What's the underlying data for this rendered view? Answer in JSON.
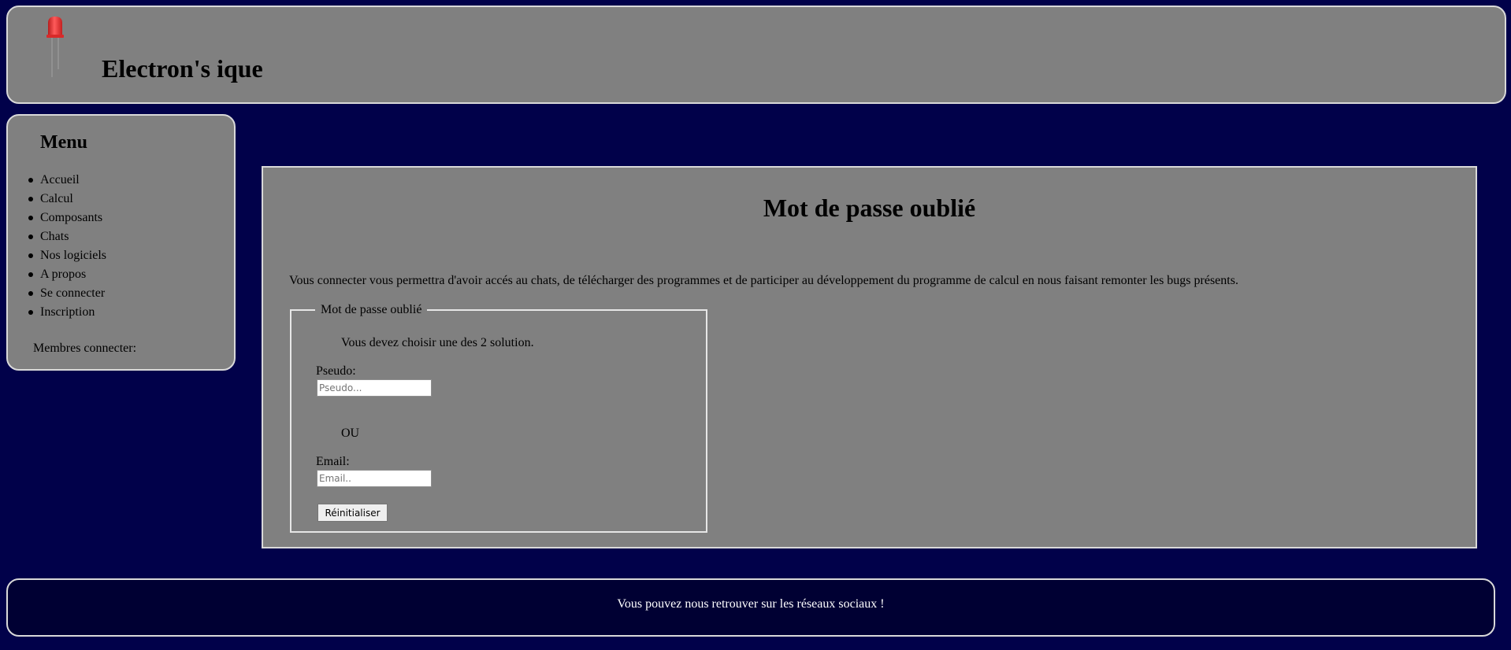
{
  "header": {
    "logo_icon": "red-led-icon",
    "site_title": "Electron's ique"
  },
  "sidebar": {
    "title": "Menu",
    "items": [
      {
        "label": "Accueil"
      },
      {
        "label": "Calcul"
      },
      {
        "label": "Composants"
      },
      {
        "label": "Chats"
      },
      {
        "label": "Nos logiciels"
      },
      {
        "label": "A propos"
      },
      {
        "label": "Se connecter"
      },
      {
        "label": "Inscription"
      }
    ],
    "members_label": "Membres connecter:"
  },
  "main": {
    "title": "Mot de passe oublié",
    "intro": "Vous connecter vous permettra d'avoir accés au chats, de télécharger des programmes et de participer au développement du programme de calcul en nous faisant remonter les bugs présents.",
    "form": {
      "legend": "Mot de passe oublié",
      "note": "Vous devez choisir une des 2 solution.",
      "pseudo_label": "Pseudo:",
      "pseudo_placeholder": "Pseudo...",
      "pseudo_value": "",
      "or_label": "OU",
      "email_label": "Email:",
      "email_placeholder": "Email..",
      "email_value": "",
      "reset_label": "Réinitialiser"
    }
  },
  "footer": {
    "text": "Vous pouvez nous retrouver sur les réseaux sociaux !"
  },
  "colors": {
    "page_background": "#01014a",
    "panel_background": "#808080",
    "panel_border": "#d9d9d9",
    "footer_background": "#000033",
    "footer_text": "#ffffff",
    "led_red": "#e83232"
  }
}
